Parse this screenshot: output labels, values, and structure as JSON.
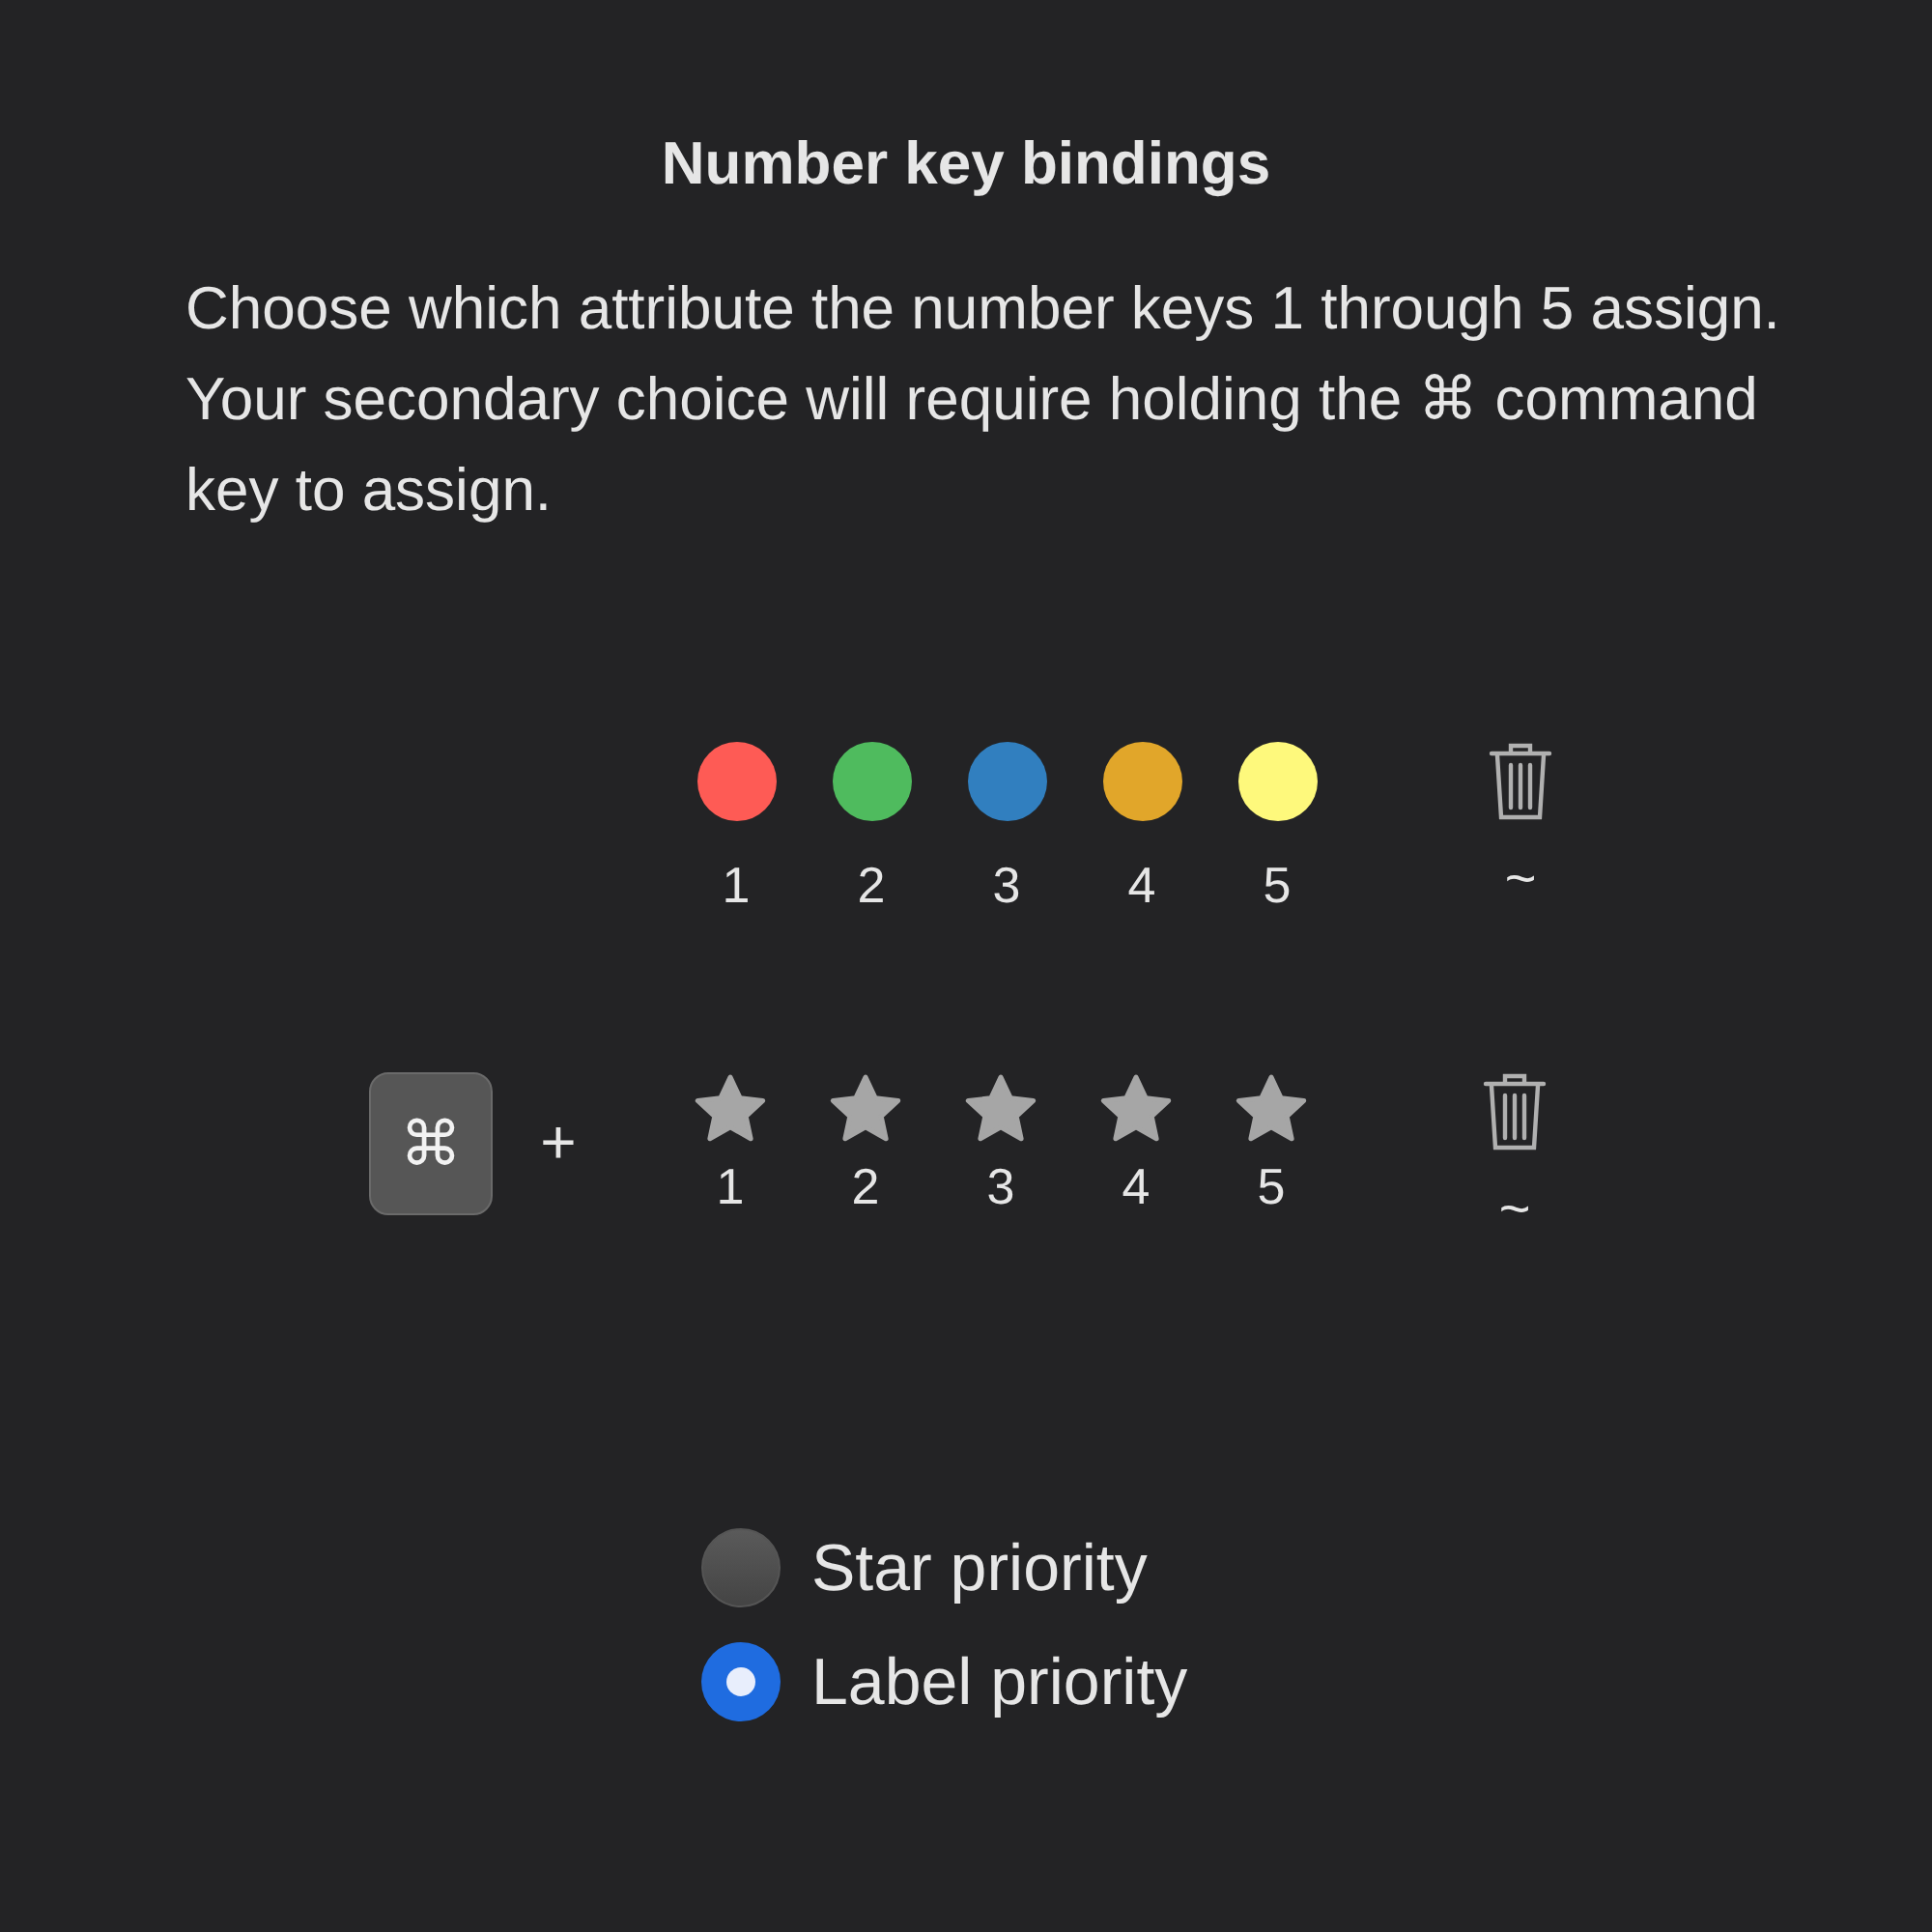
{
  "title": "Number key bindings",
  "description": "Choose which attribute the number keys 1 through 5 assign. Your secondary choice will require holding the ⌘ command key to assign.",
  "label_row": {
    "keys": [
      {
        "number": "1",
        "color": "#fe5b55"
      },
      {
        "number": "2",
        "color": "#4fbb5e"
      },
      {
        "number": "3",
        "color": "#317fbf"
      },
      {
        "number": "4",
        "color": "#e1a62a"
      },
      {
        "number": "5",
        "color": "#fef97c"
      }
    ],
    "clear_key": "~"
  },
  "star_row": {
    "modifier": "⌘",
    "plus": "+",
    "keys": [
      {
        "number": "1"
      },
      {
        "number": "2"
      },
      {
        "number": "3"
      },
      {
        "number": "4"
      },
      {
        "number": "5"
      }
    ],
    "clear_key": "~"
  },
  "priority": [
    {
      "label": "Star priority",
      "selected": false
    },
    {
      "label": "Label priority",
      "selected": true
    }
  ]
}
